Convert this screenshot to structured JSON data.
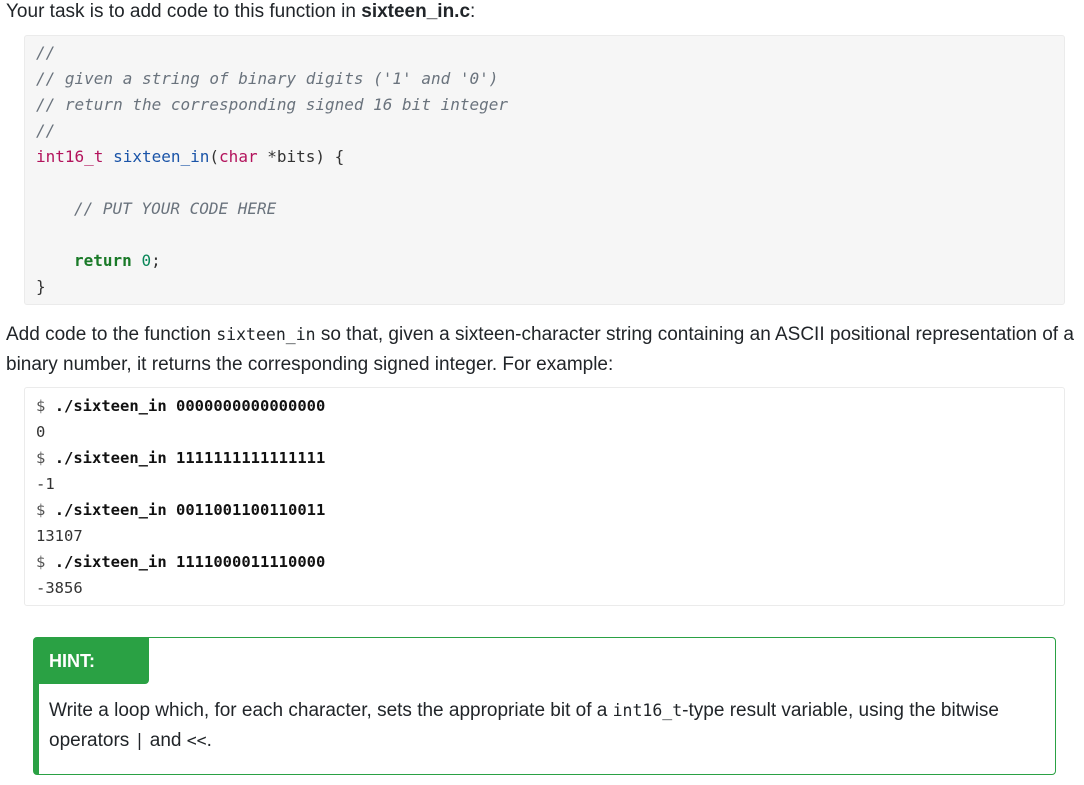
{
  "intro": {
    "prefix": "Your task is to add code to this function in ",
    "filename": "sixteen_in.c",
    "suffix": ":"
  },
  "code": {
    "comment1": "//",
    "comment2": "// given a string of binary digits ('1' and '0')",
    "comment3": "// return the corresponding signed 16 bit integer",
    "comment4": "//",
    "sig_type": "int16_t",
    "sig_name": "sixteen_in",
    "sig_open": "(",
    "sig_param_type": "char",
    "sig_rest": " *bits) {",
    "body_comment": "// PUT YOUR CODE HERE",
    "return_kw": "return",
    "return_val": "0",
    "return_semi": ";",
    "close_brace": "}"
  },
  "description": {
    "before": "Add code to the function ",
    "func": "sixteen_in",
    "after": " so that, given a sixteen-character string containing an ASCII positional representation of a binary number, it returns the corresponding signed integer. For example:"
  },
  "examples": [
    {
      "prompt": "$",
      "command": "./sixteen_in 0000000000000000",
      "output": "0"
    },
    {
      "prompt": "$",
      "command": "./sixteen_in 1111111111111111",
      "output": "-1"
    },
    {
      "prompt": "$",
      "command": "./sixteen_in 0011001100110011",
      "output": "13107"
    },
    {
      "prompt": "$",
      "command": "./sixteen_in 1111000011110000",
      "output": "-3856"
    }
  ],
  "hint": {
    "badge": "HINT:",
    "before": "Write a loop which, for each character, sets the appropriate bit of a ",
    "type": "int16_t",
    "middle": "-type result variable, using the bitwise operators ",
    "op_or": "|",
    "and": " and ",
    "op_shift": "<<",
    "end": "."
  },
  "colors": {
    "hint_accent": "#2aa144",
    "code_bg": "#f6f6f6"
  }
}
